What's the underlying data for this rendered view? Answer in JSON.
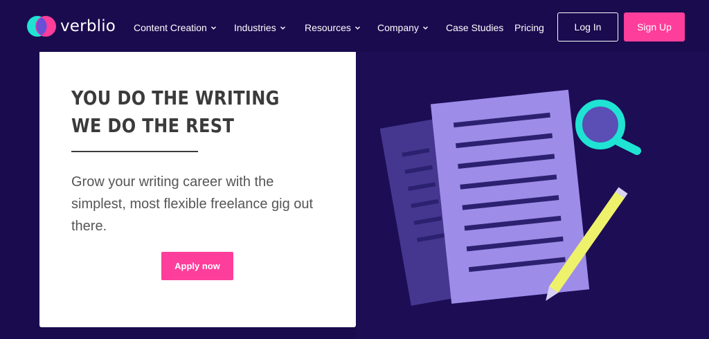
{
  "brand": {
    "name": "verblio"
  },
  "nav": {
    "items": [
      {
        "label": "Content Creation",
        "has_dropdown": true
      },
      {
        "label": "Industries",
        "has_dropdown": true
      },
      {
        "label": "Resources",
        "has_dropdown": true
      },
      {
        "label": "Company",
        "has_dropdown": true
      },
      {
        "label": "Case Studies",
        "has_dropdown": false
      },
      {
        "label": "Pricing",
        "has_dropdown": false
      }
    ],
    "login_label": "Log In",
    "signup_label": "Sign Up"
  },
  "hero": {
    "headline_line1": "YOU DO THE WRITING",
    "headline_line2": "WE DO THE REST",
    "subtext": "Grow your writing career with the simplest, most flexible freelance gig out there.",
    "cta_label": "Apply now"
  },
  "colors": {
    "background": "#190b4d",
    "accent_pink": "#fe3e9b",
    "card": "#ffffff",
    "heading_text": "#3b3b3b",
    "body_text": "#555555",
    "paper": "#9d8ce8",
    "teal": "#1fe3d3",
    "pencil": "#eef26a"
  },
  "icons": {
    "logo": "verblio-logo-icon",
    "dropdown": "chevron-down-icon",
    "illustration": [
      "document-icon",
      "magnifier-icon",
      "pencil-icon"
    ]
  }
}
